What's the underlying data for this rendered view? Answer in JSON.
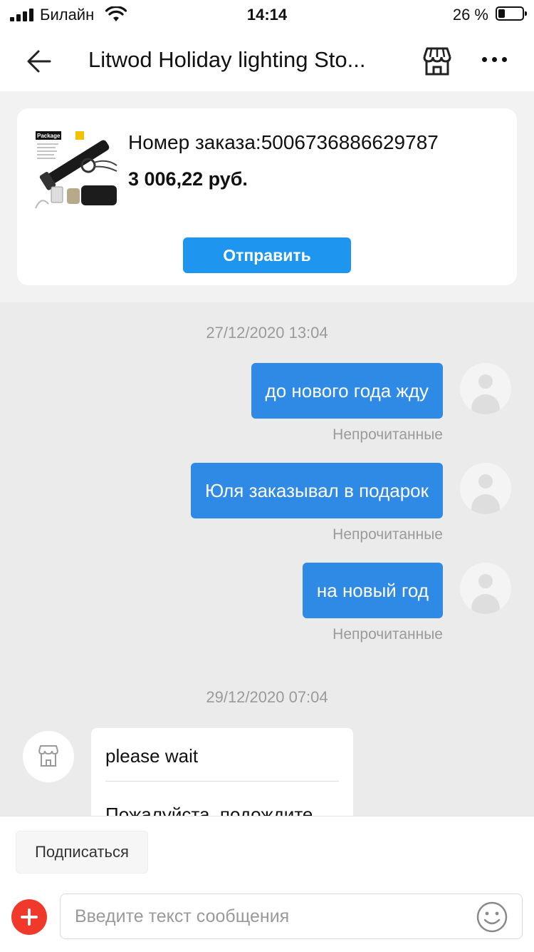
{
  "status_bar": {
    "carrier": "Билайн",
    "time": "14:14",
    "battery_percent": "26 %",
    "battery_level": 0.26
  },
  "nav": {
    "title": "Litwod Holiday lighting Sto...",
    "back_icon": "back-arrow-icon",
    "store_icon": "store-icon",
    "more_icon": "more-dots-icon"
  },
  "order": {
    "number_text": "Номер заказа:5006736886629787",
    "price": "3 006,22 руб.",
    "send_label": "Отправить",
    "product_thumb_label": "Package D"
  },
  "chat": {
    "groups": [
      {
        "date": "27/12/2020 13:04",
        "messages": [
          {
            "text": "до нового года жду",
            "status": "Непрочитанные"
          },
          {
            "text": "Юля заказывал в подарок",
            "status": "Непрочитанные"
          },
          {
            "text": "на новый год",
            "status": "Непрочитанные"
          }
        ]
      },
      {
        "date": "29/12/2020 07:04",
        "incoming": {
          "original": "please wait",
          "translation": "Пожалуйста, подождите"
        }
      }
    ]
  },
  "bottom": {
    "subscribe_label": "Подписаться",
    "input_placeholder": "Введите текст сообщения",
    "input_value": "",
    "add_icon": "plus-circle-icon",
    "emoji_icon": "smiley-icon"
  },
  "colors": {
    "accent": "#2f8ae6",
    "send_button": "#1e96f0",
    "add_button": "#f0392b",
    "chat_background": "#ebebeb"
  }
}
